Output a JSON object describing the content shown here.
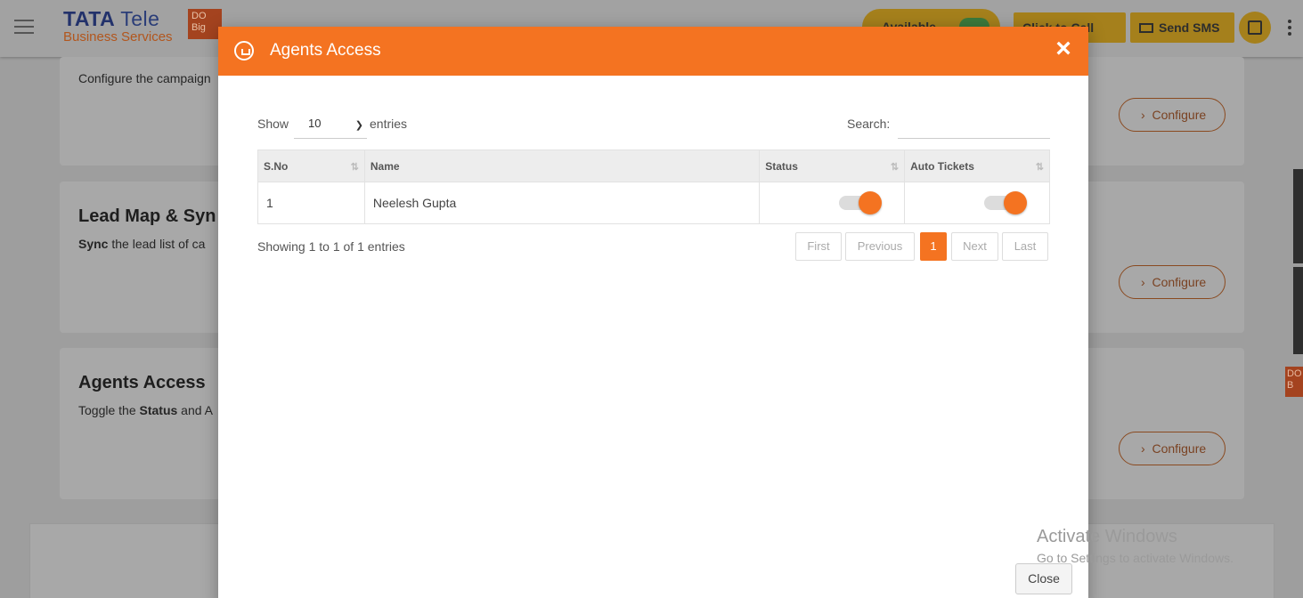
{
  "app": {
    "brand_main": "TATA",
    "brand_tele": "Tele",
    "brand_sub": "Business Services",
    "brand_badge": "DO Big",
    "available_label": "Available",
    "click_to_call_label": "Click to Call",
    "send_sms_label": "Send SMS",
    "side_badge": "DO B"
  },
  "cards": [
    {
      "title": "",
      "description": "Configure the campaign",
      "configure_label": "Configure"
    },
    {
      "title": "Lead Map & Syn",
      "description_bold": "Sync",
      "description": " the lead list of ca",
      "configure_label": "Configure"
    },
    {
      "title": "Agents Access",
      "description_pre": "Toggle the ",
      "description_bold": "Status",
      "description_post": " and A",
      "configure_label": "Configure"
    }
  ],
  "modal": {
    "title": "Agents Access",
    "close_x": "×",
    "show_label": "Show",
    "entries_value": "10",
    "entries_label": "entries",
    "search_label": "Search:",
    "search_value": "",
    "columns": [
      "S.No",
      "Name",
      "Status",
      "Auto Tickets"
    ],
    "rows": [
      {
        "sno": "1",
        "name": "Neelesh Gupta",
        "status_on": true,
        "auto_tickets_on": true
      }
    ],
    "showing_text": "Showing 1 to 1 of 1 entries",
    "pager": {
      "first": "First",
      "previous": "Previous",
      "current": "1",
      "next": "Next",
      "last": "Last"
    },
    "close_button": "Close"
  },
  "watermark": {
    "line1": "Activate Windows",
    "line2": "Go to Settings to activate Windows."
  },
  "colors": {
    "accent": "#f47321"
  }
}
